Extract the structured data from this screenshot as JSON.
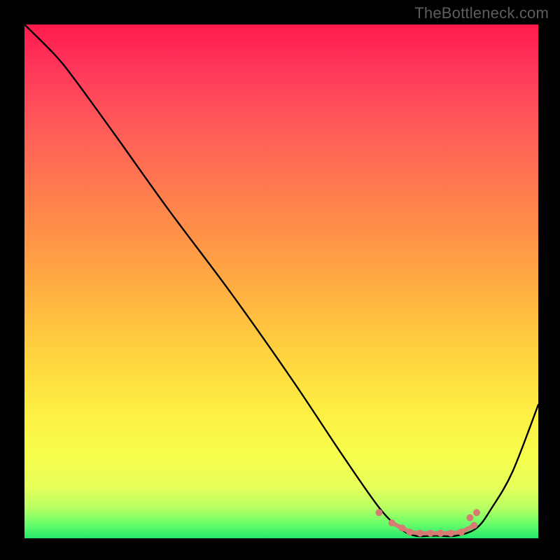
{
  "watermark": "TheBottleneck.com",
  "chart_data": {
    "type": "line",
    "title": "",
    "xlabel": "",
    "ylabel": "",
    "xlim": [
      0,
      100
    ],
    "ylim": [
      0,
      100
    ],
    "series": [
      {
        "name": "bottleneck-curve",
        "color": "#000000",
        "x": [
          0,
          6,
          10,
          18,
          28,
          40,
          52,
          62,
          69,
          73,
          76,
          80,
          84,
          88,
          91,
          95,
          100
        ],
        "values": [
          100,
          94,
          89,
          78,
          64,
          48,
          31,
          16,
          6,
          2,
          0.5,
          0.5,
          0.5,
          2,
          6,
          13,
          26
        ]
      }
    ],
    "markers": {
      "name": "selected-range",
      "color": "#d67a74",
      "x": [
        69.0,
        71.5,
        73.5,
        75.0,
        77.0,
        79.0,
        81.0,
        83.0,
        85.0,
        87.5,
        86.7,
        88.0
      ],
      "values": [
        5.0,
        3.0,
        2.0,
        1.2,
        1.0,
        1.0,
        1.0,
        1.0,
        1.2,
        2.5,
        4.0,
        5.0
      ]
    },
    "gradient": {
      "stops": [
        {
          "pos": 0,
          "color": "#ff1a4d"
        },
        {
          "pos": 8,
          "color": "#ff355a"
        },
        {
          "pos": 20,
          "color": "#ff5b59"
        },
        {
          "pos": 32,
          "color": "#ff7b4e"
        },
        {
          "pos": 44,
          "color": "#ff9a46"
        },
        {
          "pos": 55,
          "color": "#ffb940"
        },
        {
          "pos": 66,
          "color": "#ffd83f"
        },
        {
          "pos": 76,
          "color": "#fdf043"
        },
        {
          "pos": 84,
          "color": "#f7fe4d"
        },
        {
          "pos": 90,
          "color": "#e6ff5a"
        },
        {
          "pos": 94,
          "color": "#b8ff62"
        },
        {
          "pos": 97,
          "color": "#6eff6a"
        },
        {
          "pos": 100,
          "color": "#24e76b"
        }
      ]
    }
  }
}
